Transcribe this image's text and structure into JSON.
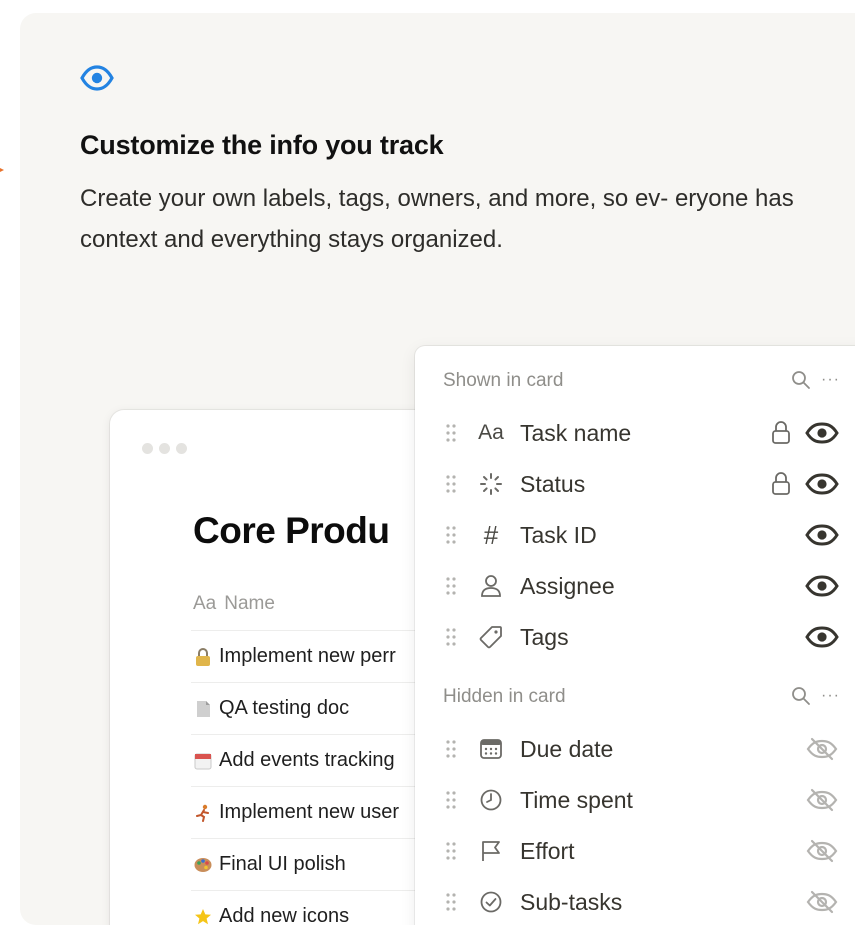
{
  "feature": {
    "title": "Customize the info you track",
    "description": "Create your own labels, tags, owners, and more, so ev- eryone has context and everything stays organized.",
    "icon": "eye-icon",
    "accent_color": "#2383e2"
  },
  "page": {
    "title": "Core Produ",
    "column_header": {
      "icon": "Aa",
      "label": "Name"
    },
    "rows": [
      {
        "icon": "lock-emoji",
        "label": "Implement new perr"
      },
      {
        "icon": "page-emoji",
        "label": "QA testing doc"
      },
      {
        "icon": "calendar-emoji",
        "label": "Add events tracking"
      },
      {
        "icon": "runner-emoji",
        "label": "Implement new user"
      },
      {
        "icon": "palette-emoji",
        "label": "Final UI polish"
      },
      {
        "icon": "star-emoji",
        "label": "Add new icons"
      }
    ]
  },
  "properties": {
    "shown_label": "Shown in card",
    "hidden_label": "Hidden in card",
    "more_symbol": "···",
    "text_type_symbol": "Aa",
    "hash_symbol": "#",
    "shown": [
      {
        "label": "Task name",
        "icon": "text-type-icon",
        "locked": true,
        "visible": true
      },
      {
        "label": "Status",
        "icon": "status-icon",
        "locked": true,
        "visible": true
      },
      {
        "label": "Task ID",
        "icon": "hash-icon",
        "locked": false,
        "visible": true
      },
      {
        "label": "Assignee",
        "icon": "person-icon",
        "locked": false,
        "visible": true
      },
      {
        "label": "Tags",
        "icon": "tag-icon",
        "locked": false,
        "visible": true
      }
    ],
    "hidden": [
      {
        "label": "Due date",
        "icon": "calendar-icon",
        "visible": false
      },
      {
        "label": "Time spent",
        "icon": "clock-icon",
        "visible": false
      },
      {
        "label": "Effort",
        "icon": "flag-icon",
        "visible": false
      },
      {
        "label": "Sub-tasks",
        "icon": "check-circle-icon",
        "visible": false
      }
    ]
  }
}
